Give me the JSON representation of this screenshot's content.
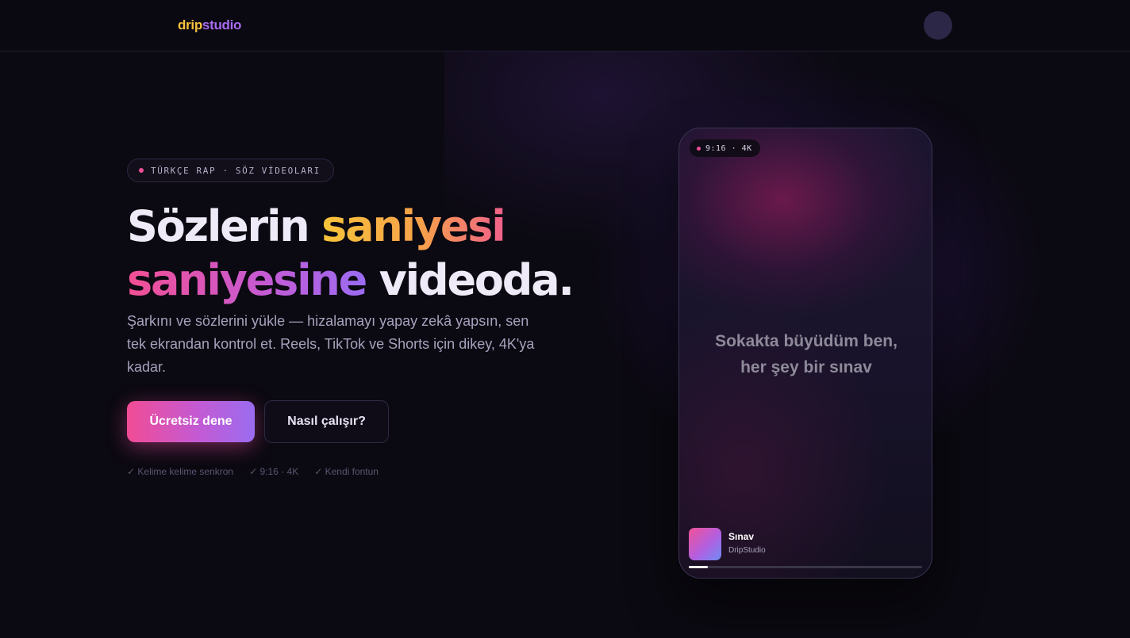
{
  "header": {
    "logo_part1": "drip",
    "logo_part2": "studio"
  },
  "hero": {
    "pill_text": "TÜRKÇE RAP · SÖZ VİDEOLARI",
    "headline_1": "Sözlerin ",
    "headline_2": "saniyesi",
    "headline_3": "saniyesine",
    "headline_4": " videoda.",
    "description": "Şarkını ve sözlerini yükle — hizalamayı yapay zekâ yapsın, sen tek ekrandan kontrol et. Reels, TikTok ve Shorts için dikey, 4K'ya kadar.",
    "primary_button": "Ücretsiz dene",
    "secondary_button": "Nasıl çalışır?",
    "features": [
      "✓ Kelime kelime senkron",
      "✓ 9:16 · 4K",
      "✓ Kendi fontun"
    ]
  },
  "preview": {
    "badge": "9:16 · 4K",
    "lyric_line_1": "Sokakta büyüdüm ben,",
    "lyric_line_2": "her şey bir sınav",
    "track_title": "Sınav",
    "track_artist": "DripStudio",
    "progress": 0.08
  },
  "colors": {
    "accent_pink": "#f14c95",
    "accent_purple": "#9b6cf0",
    "accent_yellow": "#f8c43a",
    "background": "#0b0911"
  }
}
